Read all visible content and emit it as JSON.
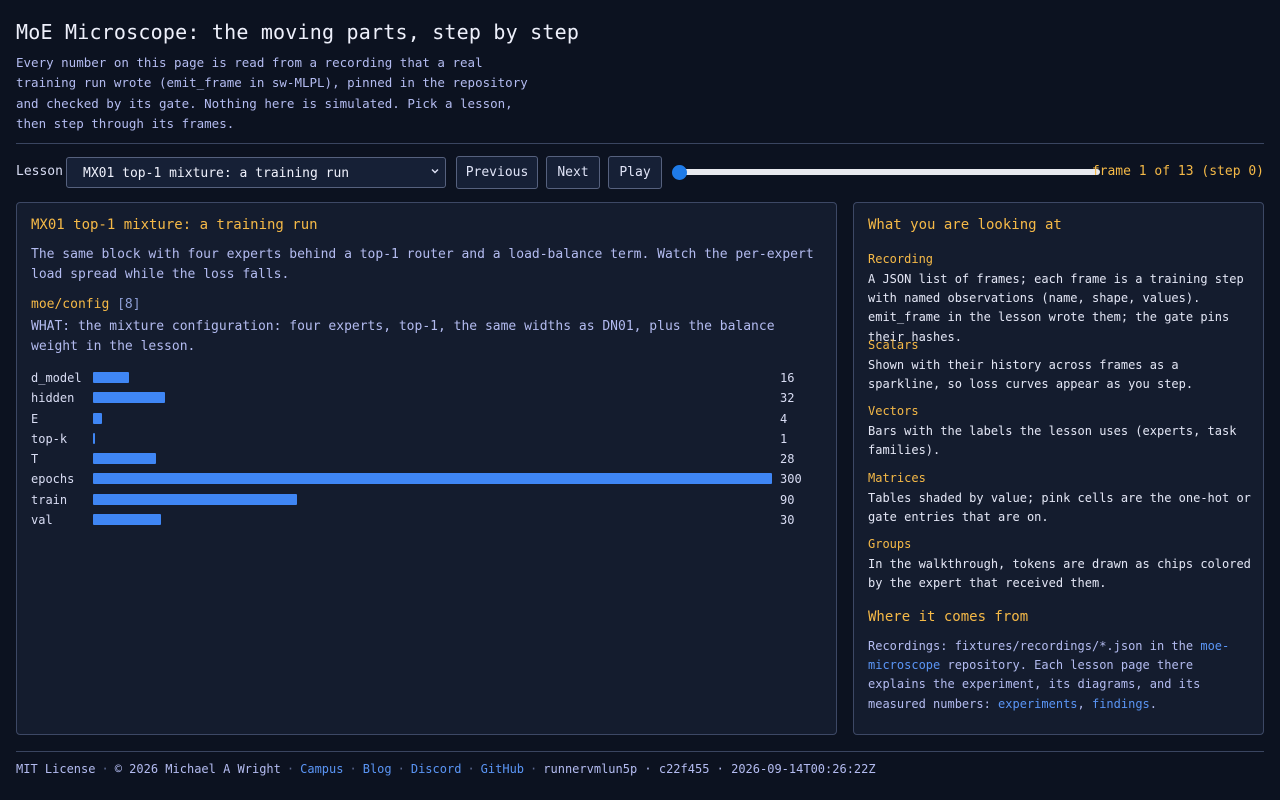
{
  "header": {
    "title": "MoE Microscope: the moving parts, step by step",
    "intro": "Every number on this page is read from a recording that a real training run wrote (emit_frame in sw-MLPL), pinned in the repository and checked by its gate. Nothing here is simulated. Pick a lesson, then step through its frames."
  },
  "controls": {
    "lesson_label": "Lesson",
    "lesson_selected": "MX01 top-1 mixture: a training run",
    "previous_label": "Previous",
    "next_label": "Next",
    "play_label": "Play",
    "slider_progress": 0,
    "frame_info": "frame 1 of 13 (step 0)"
  },
  "lesson": {
    "title": "MX01 top-1 mixture: a training run",
    "description": "The same block with four experts behind a top-1 router and a load-balance term. Watch the per-expert load spread while the loss falls.",
    "observation": {
      "name": "moe/config",
      "shape": "[8]",
      "what": "WHAT: the mixture configuration: four experts, top-1, the same widths as DN01, plus the balance weight in the lesson."
    }
  },
  "chart_data": {
    "type": "bar",
    "orientation": "horizontal",
    "categories": [
      "d_model",
      "hidden",
      "E",
      "top-k",
      "T",
      "epochs",
      "train",
      "val"
    ],
    "values": [
      16,
      32,
      4,
      1,
      28,
      300,
      90,
      30
    ],
    "value_labels": [
      "16",
      "32",
      "4",
      "1",
      "28",
      "300",
      "90",
      "30"
    ],
    "xlim": [
      0,
      300
    ],
    "bar_color": "#3f86f5",
    "grid": false
  },
  "guide": {
    "heading": "What you are looking at",
    "sections": [
      {
        "title": "Recording",
        "text": "A JSON list of frames; each frame is a training step with named observations (name, shape, values). emit_frame in the lesson wrote them; the gate pins their hashes."
      },
      {
        "title": "Scalars",
        "text": "Shown with their history across frames as a sparkline, so loss curves appear as you step."
      },
      {
        "title": "Vectors",
        "text": "Bars with the labels the lesson uses (experts, task families)."
      },
      {
        "title": "Matrices",
        "text": "Tables shaded by value; pink cells are the one-hot or gate entries that are on."
      },
      {
        "title": "Groups",
        "text": "In the walkthrough, tokens are drawn as chips colored by the expert that received them."
      }
    ],
    "source_heading": "Where it comes from",
    "source": {
      "pre": "Recordings: fixtures/recordings/*.json in the ",
      "repo_link": "moe-microscope",
      "mid": " repository. Each lesson page there explains the experiment, its diagrams, and its measured numbers: ",
      "experiments_link": "experiments",
      "comma": ", ",
      "findings_link": "findings",
      "end": "."
    }
  },
  "footer": {
    "license": "MIT License",
    "copyright": "© 2026 Michael A Wright",
    "links": [
      "Campus",
      "Blog",
      "Discord",
      "GitHub"
    ],
    "build": "runnervmlun5p · c22f455 · 2026-09-14T00:26:22Z"
  },
  "colors": {
    "background": "#0c1220",
    "panel": "#141c2e",
    "accent": "#f5b947",
    "link": "#5a95f5",
    "bar": "#3f86f5"
  }
}
